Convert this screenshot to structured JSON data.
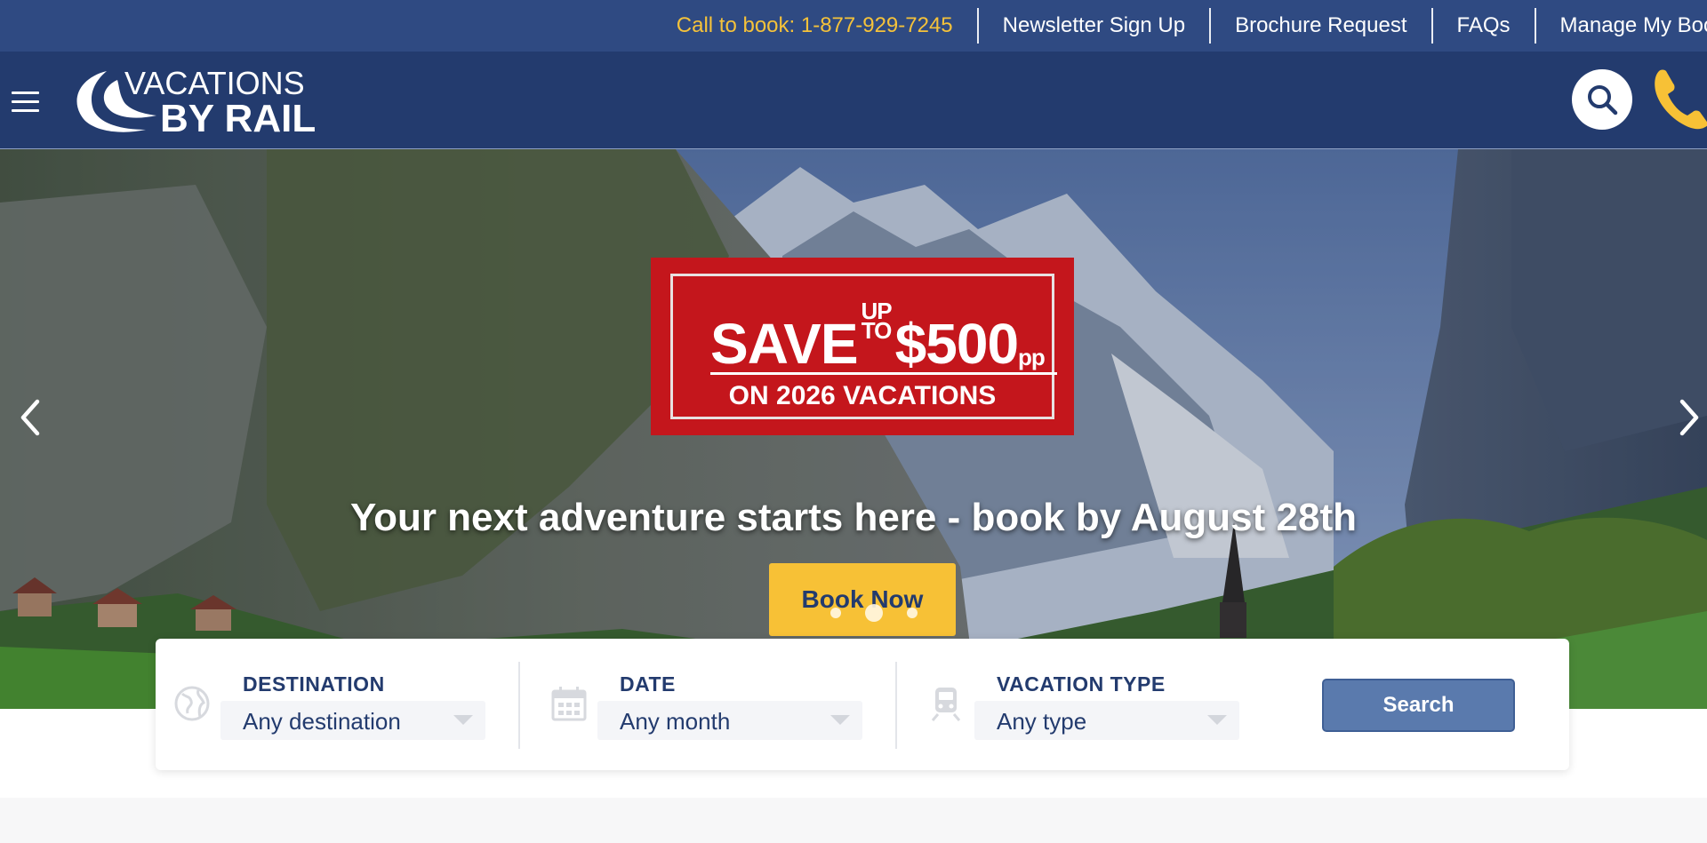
{
  "topbar": {
    "phone_link": "Call to book: 1-877-929-7245",
    "newsletter": "Newsletter Sign Up",
    "brochure": "Brochure Request",
    "faqs": "FAQs",
    "manage_booking": "Manage My Bookin"
  },
  "header": {
    "logo_line1": "VACATIONS",
    "logo_line2": "BY RAIL",
    "icons": [
      "menu-icon",
      "search-icon",
      "phone-icon"
    ]
  },
  "hero": {
    "promo": {
      "save": "SAVE",
      "up": "UP",
      "to": "TO",
      "amount": "$500",
      "pp": "pp",
      "subline": "ON 2026 VACATIONS"
    },
    "headline": "Your next adventure starts here - book by August 28th",
    "cta": "Book Now",
    "slides_total": 3,
    "active_slide": 2
  },
  "search": {
    "destination": {
      "label": "DESTINATION",
      "value": "Any destination",
      "icon": "globe-icon"
    },
    "date": {
      "label": "DATE",
      "value": "Any month",
      "icon": "calendar-icon"
    },
    "vacation_type": {
      "label": "VACATION TYPE",
      "value": "Any type",
      "icon": "train-icon"
    },
    "submit": "Search"
  },
  "colors": {
    "topbar_bg": "#2f4a82",
    "header_bg": "#233b6e",
    "accent_yellow": "#f7c136",
    "promo_red": "#c4161c",
    "search_button": "#5a7aad"
  }
}
